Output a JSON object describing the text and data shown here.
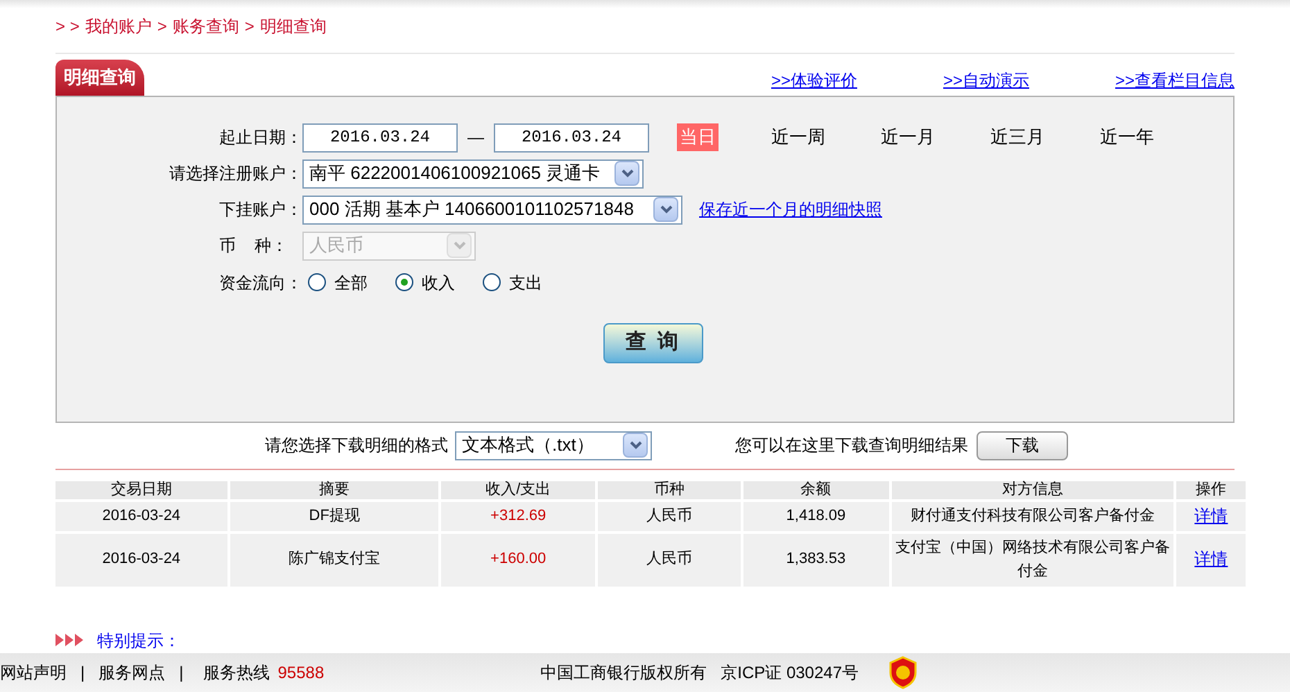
{
  "breadcrumb": [
    "> >",
    "我的账户",
    ">",
    "账务查询",
    ">",
    "明细查询"
  ],
  "panel_tab": "明细查询",
  "top_links": [
    ">>体验评价",
    ">>自动演示",
    ">>查看栏目信息"
  ],
  "form": {
    "date_label": "起止日期：",
    "date_from": "2016.03.24",
    "date_sep": "—",
    "date_to": "2016.03.24",
    "ranges": [
      {
        "label": "当日",
        "selected": true
      },
      {
        "label": "近一周",
        "selected": false
      },
      {
        "label": "近一月",
        "selected": false
      },
      {
        "label": "近三月",
        "selected": false
      },
      {
        "label": "近一年",
        "selected": false
      }
    ],
    "account_label": "请选择注册账户：",
    "account_value": "南平  6222001406100921065 灵通卡",
    "sub_account_label": "下挂账户：",
    "sub_account_value": "000 活期 基本户 1406600101102571848",
    "snapshot_link": "保存近一个月的明细快照",
    "currency_label": "币    种：",
    "currency_value": "人民币",
    "currency_disabled": true,
    "flow_label": "资金流向：",
    "flows": [
      {
        "label": "全部",
        "selected": false
      },
      {
        "label": "收入",
        "selected": true
      },
      {
        "label": "支出",
        "selected": false
      }
    ],
    "query_button": "查 询"
  },
  "download": {
    "format_label": "请您选择下载明细的格式",
    "format_value": "文本格式（.txt）",
    "hint": "您可以在这里下载查询明细结果",
    "button": "下载"
  },
  "table": {
    "columns": [
      "交易日期",
      "摘要",
      "收入/支出",
      "币种",
      "余额",
      "对方信息",
      "操作"
    ],
    "rows": [
      {
        "date": "2016-03-24",
        "summary": "DF提现",
        "amount": "+312.69",
        "currency": "人民币",
        "balance": "1,418.09",
        "counterparty": "财付通支付科技有限公司客户备付金",
        "action": "详情"
      },
      {
        "date": "2016-03-24",
        "summary": "陈广锦支付宝",
        "amount": "+160.00",
        "currency": "人民币",
        "balance": "1,383.53",
        "counterparty": "支付宝（中国）网络技术有限公司客户备付金",
        "action": "详情"
      }
    ]
  },
  "notice": "特别提示：",
  "footer": {
    "links": [
      "网站声明",
      "|",
      "服务网点",
      "|"
    ],
    "hotline_label": "服务热线",
    "hotline": "95588",
    "copyright": "中国工商银行版权所有",
    "icp": "京ICP证 030247号"
  }
}
